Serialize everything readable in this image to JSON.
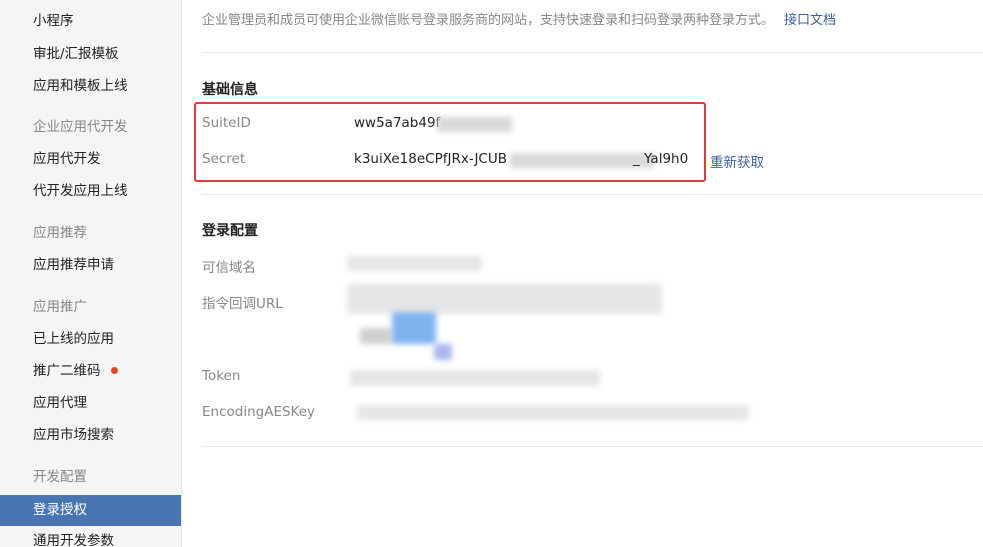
{
  "sidebar": {
    "items": [
      {
        "label": "小程序",
        "type": "item"
      },
      {
        "label": "审批/汇报模板",
        "type": "item"
      },
      {
        "label": "应用和模板上线",
        "type": "item"
      },
      {
        "label": "企业应用代开发",
        "type": "group"
      },
      {
        "label": "应用代开发",
        "type": "item"
      },
      {
        "label": "代开发应用上线",
        "type": "item"
      },
      {
        "label": "应用推荐",
        "type": "group"
      },
      {
        "label": "应用推荐申请",
        "type": "item"
      },
      {
        "label": "应用推广",
        "type": "group"
      },
      {
        "label": "已上线的应用",
        "type": "item"
      },
      {
        "label": "推广二维码",
        "type": "item",
        "badge": "red-dot"
      },
      {
        "label": "应用代理",
        "type": "item"
      },
      {
        "label": "应用市场搜索",
        "type": "item"
      },
      {
        "label": "开发配置",
        "type": "group"
      },
      {
        "label": "登录授权",
        "type": "item",
        "active": true
      },
      {
        "label": "通用开发参数",
        "type": "item"
      }
    ]
  },
  "main": {
    "intro_text": "企业管理员和成员可使用企业微信账号登录服务商的网站，支持快速登录和扫码登录两种登录方式。",
    "intro_link": "接口文档",
    "basic_info": {
      "title": "基础信息",
      "suite_id_label": "SuiteID",
      "suite_id_value": "ww5a7ab49f",
      "secret_label": "Secret",
      "secret_value_start": "k3uiXe18eCPfJRx-JCUB",
      "secret_value_end": "_ Yal9h0",
      "refetch_link": "重新获取"
    },
    "login_config": {
      "title": "登录配置",
      "trusted_domain_label": "可信域名",
      "callback_url_label": "指令回调URL",
      "token_label": "Token",
      "aes_key_label": "EncodingAESKey"
    }
  },
  "colors": {
    "accent": "#4a75b3",
    "link": "#3d63a6",
    "highlight_box": "#e03b3b",
    "badge": "#e8461e"
  }
}
